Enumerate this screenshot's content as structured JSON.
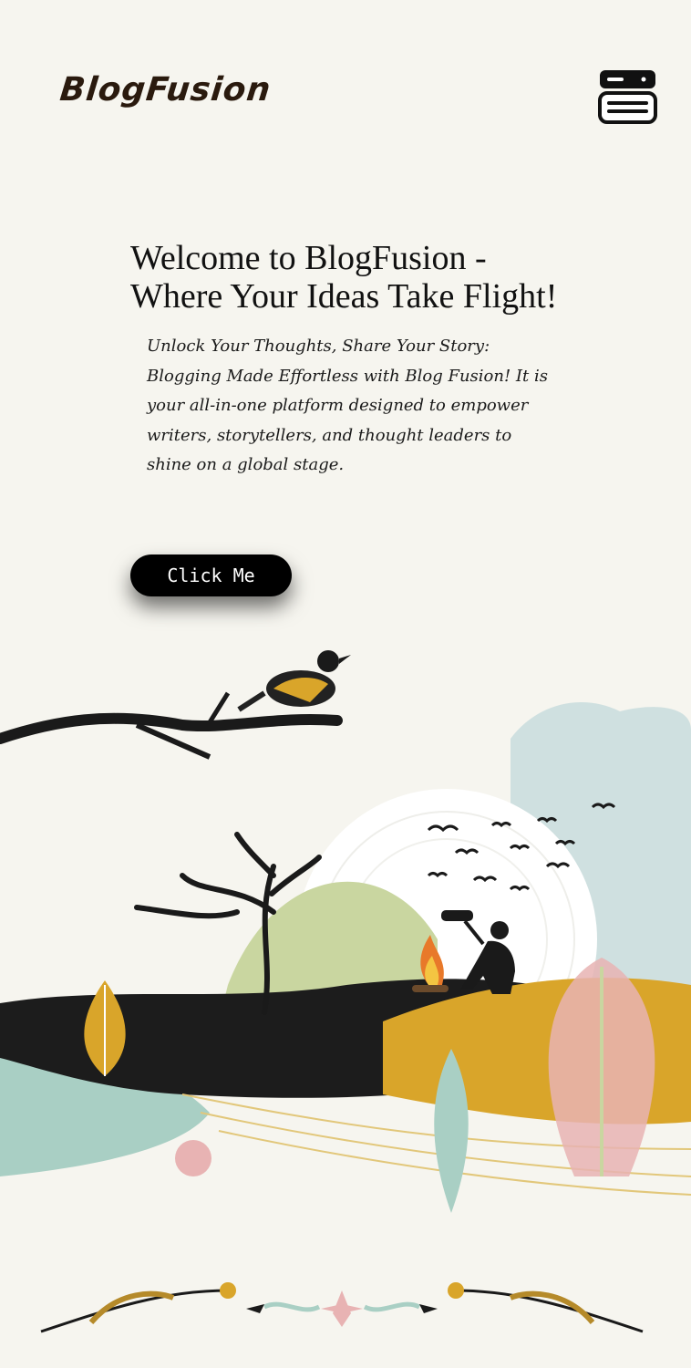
{
  "header": {
    "logo_text": "BlogFusion",
    "menu_icon": "menu-icon"
  },
  "hero": {
    "title": "Welcome to BlogFusion - Where Your Ideas Take Flight!",
    "text": "Unlock Your Thoughts, Share Your Story: Blogging Made Effortless with Blog Fusion! It is your all-in-one platform designed to empower writers, storytellers, and thought leaders to shine on a global stage.",
    "button_label": "Click Me"
  },
  "colors": {
    "background": "#f6f5ef",
    "text": "#111111",
    "button": "#000000",
    "mustard": "#d9a52a",
    "sage": "#c9d6a0",
    "mint": "#a9cfc4",
    "pink": "#e8b3b3",
    "sky": "#cfe0e0"
  },
  "illustration": {
    "icons": [
      "bird-on-branch-icon",
      "tree-icon",
      "moon-icon",
      "campfire-icon",
      "photographer-icon",
      "leaf-icon",
      "flock-of-birds-icon"
    ]
  }
}
